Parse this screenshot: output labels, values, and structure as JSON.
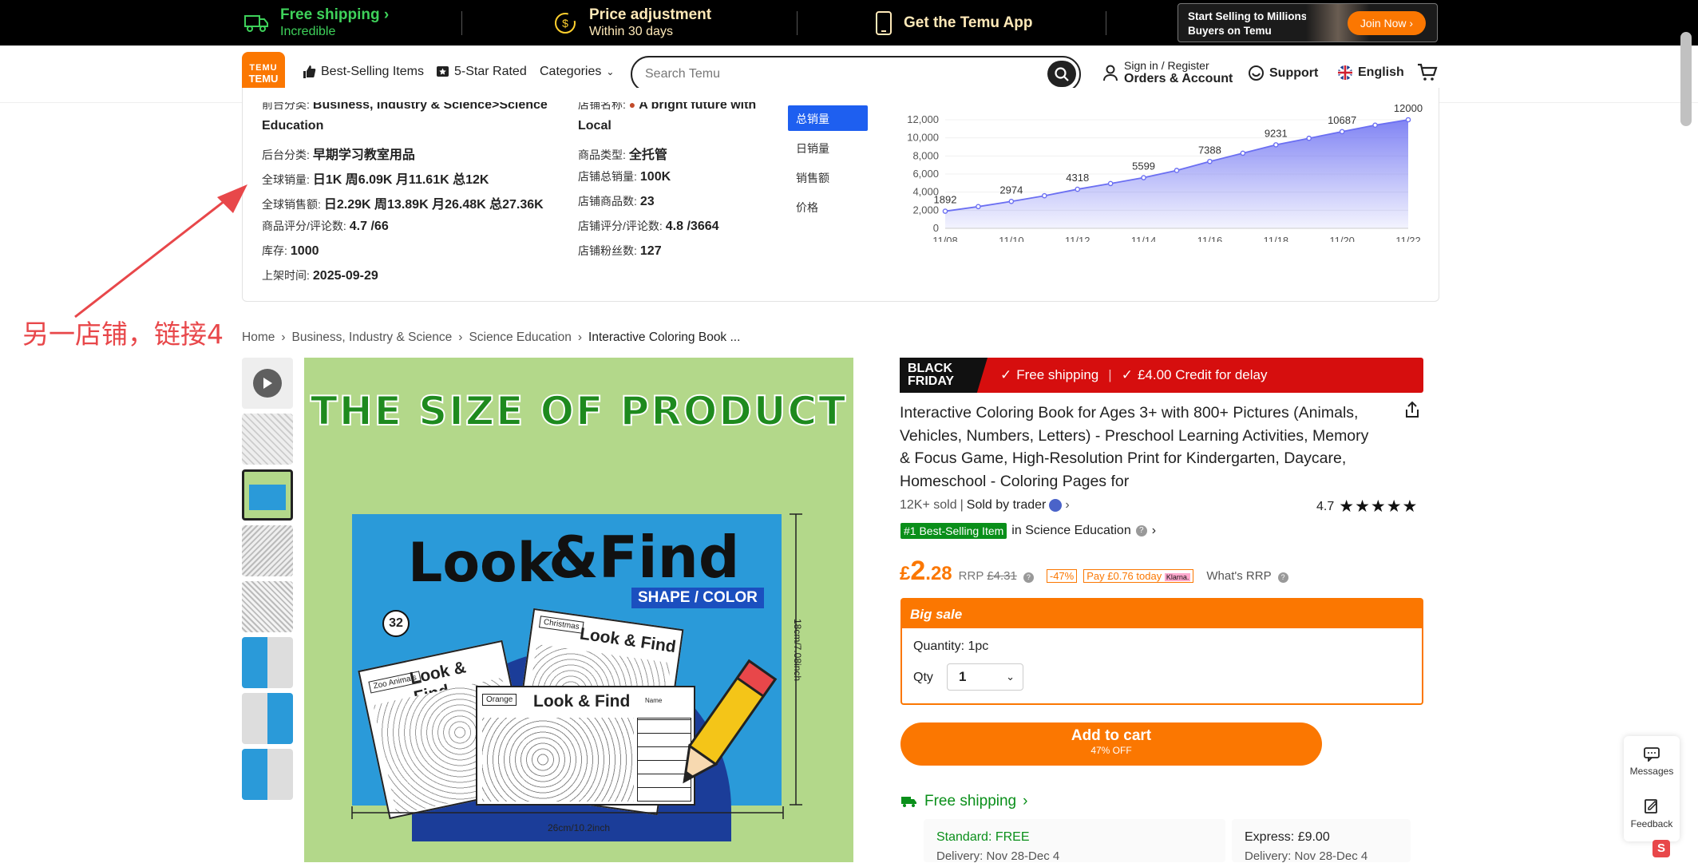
{
  "topbar": {
    "free_shipping": "Free shipping",
    "free_shipping_sub": "Incredible",
    "price_adjust": "Price adjustment",
    "price_adjust_sub": "Within 30 days",
    "get_app": "Get the Temu App",
    "sell_text": "Start Selling to Millions of Buyers on Temu",
    "join_now": "Join Now"
  },
  "nav": {
    "logo_top": "TEMU",
    "logo_bottom": "TEMU",
    "best_selling": "Best-Selling Items",
    "five_star": "5-Star Rated",
    "categories": "Categories",
    "search_placeholder": "Search Temu",
    "sign_in": "Sign in / Register",
    "orders": "Orders & Account",
    "support": "Support",
    "language": "English"
  },
  "panel": {
    "col1": {
      "row0_label": "前台分类:",
      "row0_value": "Business, Industry & Science>Science",
      "row0_cont": "Education",
      "row1_label": "后台分类:",
      "row1_value": "早期学习教室用品",
      "row2_label": "全球销量:",
      "row2_value": "日1K 周6.09K 月11.61K 总12K",
      "row3_label": "全球销售额:",
      "row3_value": "日2.29K 周13.89K 月26.48K 总27.36K",
      "row4_label": "商品评分/评论数:",
      "row4_value": "4.7 /66",
      "row5_label": "库存:",
      "row5_value": "1000",
      "row6_label": "上架时间:",
      "row6_value": "2025-09-29"
    },
    "col2": {
      "row0_label": "店铺名称:",
      "row0_value": "A bright future with",
      "row0_cont": "Local",
      "row1_label": "商品类型:",
      "row1_value": "全托管",
      "row2_label": "店铺总销量:",
      "row2_value": "100K",
      "row3_label": "店铺商品数:",
      "row3_value": "23",
      "row4_label": "店铺评分/评论数:",
      "row4_value": "4.8 /3664",
      "row5_label": "店铺粉丝数:",
      "row5_value": "127"
    },
    "tabs": [
      "总销量",
      "日销量",
      "销售额",
      "价格"
    ]
  },
  "chart_data": {
    "type": "area",
    "x": [
      "11/08",
      "11/09",
      "11/10",
      "11/11",
      "11/12",
      "11/13",
      "11/14",
      "11/15",
      "11/16",
      "11/17",
      "11/18",
      "11/19",
      "11/20",
      "11/21",
      "11/22"
    ],
    "x_tick_labels": [
      "11/08",
      "11/10",
      "11/12",
      "11/14",
      "11/16",
      "11/18",
      "11/20",
      "11/22"
    ],
    "values": [
      1892,
      2400,
      2974,
      3600,
      4318,
      4950,
      5599,
      6400,
      7388,
      8300,
      9231,
      9950,
      10687,
      11400,
      12000
    ],
    "point_labels": {
      "11/08": "1892",
      "11/10": "2974",
      "11/12": "4318",
      "11/14": "5599",
      "11/16": "7388",
      "11/18": "9231",
      "11/20": "10687",
      "11/22": "12000"
    },
    "y_ticks": [
      "0",
      "2,000",
      "4,000",
      "6,000",
      "8,000",
      "10,000",
      "12,000"
    ],
    "ylim": [
      0,
      12000
    ],
    "color": "#6b6ff2",
    "grid": true
  },
  "annotation": "另一店铺，链接4",
  "breadcrumb": [
    "Home",
    "Business, Industry & Science",
    "Science Education",
    "Interactive Coloring Book ..."
  ],
  "image": {
    "banner": "THE SIZE OF PRODUCT",
    "look": "Look",
    "find": "&Find",
    "shape_color": "SHAPE / COLOR",
    "count": "32",
    "width_label": "26cm/10.2inch",
    "height_label": "18cm/7.08inch",
    "page1": "Look & Find",
    "page2": "Look & Find",
    "page3": "Look & Find",
    "tag1": "Christmas",
    "tag2": "Zoo Animals",
    "tag3": "Orange",
    "name": "Name"
  },
  "product": {
    "bf_line1": "BLACK",
    "bf_line2": "FRIDAY",
    "free_shipping": "Free shipping",
    "credit": "£4.00 Credit for delay",
    "title": "Interactive Coloring Book for Ages 3+ with 800+ Pictures (Animals, Vehicles, Numbers, Letters) - Preschool Learning Activities, Memory & Focus Game, High-Resolution Print for Kindergarten, Daycare, Homeschool - Coloring Pages for",
    "sold": "12K+ sold",
    "sold_by": "Sold by trader",
    "rating": "4.7",
    "badge": "#1 Best-Selling Item",
    "badge_in": "in Science Education",
    "price_symbol": "£",
    "price_int": "2",
    "price_dec": ".28",
    "rrp_label": "RRP",
    "rrp": "£4.31",
    "discount": "-47%",
    "pay_today": "Pay £0.76 today",
    "klarna": "Klarna.",
    "whats_rrp": "What's RRP",
    "big_sale": "Big sale",
    "quantity": "Quantity: 1pc",
    "qty_label": "Qty",
    "qty_value": "1",
    "add_to_cart": "Add to cart",
    "cart_off": "47% OFF",
    "shipping_link": "Free shipping",
    "standard": "Standard: FREE",
    "standard_delivery": "Delivery: Nov 28-Dec 4",
    "express": "Express: £9.00",
    "express_delivery": "Delivery: Nov 28-Dec 4"
  },
  "sidebar": {
    "messages": "Messages",
    "feedback": "Feedback"
  }
}
